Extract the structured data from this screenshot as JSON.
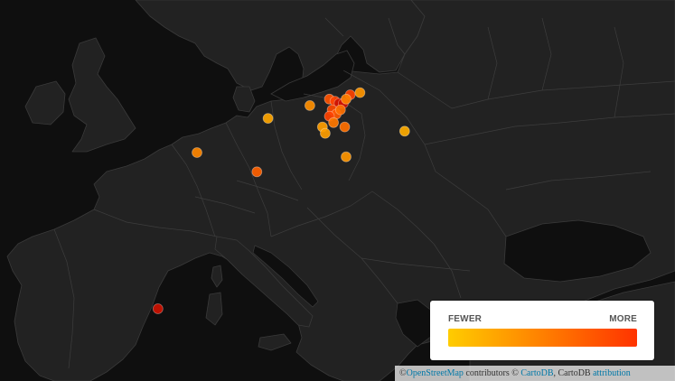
{
  "legend": {
    "low_label": "FEWER",
    "high_label": "MORE",
    "gradient_start": "#ffcc00",
    "gradient_end": "#ff3300"
  },
  "attribution": {
    "prefix": "©",
    "osm_link": "OpenStreetMap",
    "contributors": "contributors ©",
    "cartodb_link": "CartoDB",
    "cartodb_text": ", CartoDB",
    "attribution_link": "attribution"
  },
  "colors": {
    "background": "#0f0f0f",
    "land": "#222222",
    "sea": "#0f0f0f",
    "borders": "#3d3d3d",
    "point_fewer": "#ffcc00",
    "point_more": "#ff3300"
  },
  "points": [
    {
      "lon": 6.9,
      "lat": 50.9,
      "intensity": 0.45
    },
    {
      "lon": 12.0,
      "lat": 52.5,
      "intensity": 0.25
    },
    {
      "lon": 11.2,
      "lat": 50.0,
      "intensity": 0.7
    },
    {
      "lon": 15.0,
      "lat": 53.1,
      "intensity": 0.4
    },
    {
      "lon": 16.4,
      "lat": 53.4,
      "intensity": 0.8
    },
    {
      "lon": 16.8,
      "lat": 53.3,
      "intensity": 0.9
    },
    {
      "lon": 17.1,
      "lat": 53.2,
      "intensity": 1.0
    },
    {
      "lon": 17.4,
      "lat": 53.2,
      "intensity": 0.95
    },
    {
      "lon": 16.6,
      "lat": 52.9,
      "intensity": 0.85
    },
    {
      "lon": 16.9,
      "lat": 52.7,
      "intensity": 0.75
    },
    {
      "lon": 17.2,
      "lat": 52.9,
      "intensity": 0.6
    },
    {
      "lon": 16.4,
      "lat": 52.6,
      "intensity": 0.9
    },
    {
      "lon": 17.9,
      "lat": 53.6,
      "intensity": 0.9
    },
    {
      "lon": 18.6,
      "lat": 53.7,
      "intensity": 0.35
    },
    {
      "lon": 17.6,
      "lat": 53.4,
      "intensity": 0.5
    },
    {
      "lon": 16.7,
      "lat": 52.3,
      "intensity": 0.55
    },
    {
      "lon": 15.9,
      "lat": 52.1,
      "intensity": 0.3
    },
    {
      "lon": 17.5,
      "lat": 52.1,
      "intensity": 0.6
    },
    {
      "lon": 16.1,
      "lat": 51.8,
      "intensity": 0.3
    },
    {
      "lon": 17.6,
      "lat": 50.7,
      "intensity": 0.35
    },
    {
      "lon": 21.8,
      "lat": 51.9,
      "intensity": 0.2
    },
    {
      "lon": 4.1,
      "lat": 43.6,
      "intensity": 1.0
    }
  ]
}
